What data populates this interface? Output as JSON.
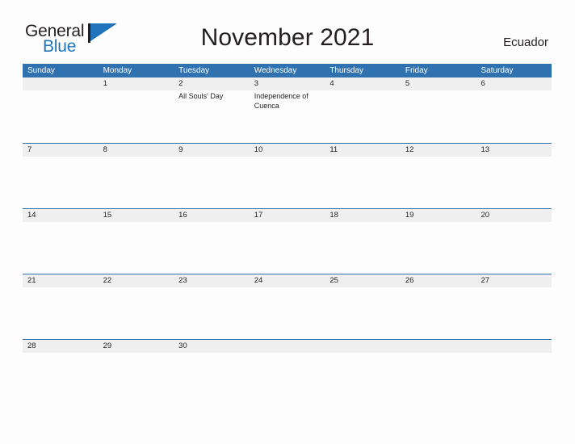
{
  "brand": {
    "name_part1": "General",
    "name_part2": "Blue",
    "flag_icon": "pennant-flag-icon",
    "accent_color": "#1f74bb"
  },
  "header": {
    "title": "November 2021",
    "country": "Ecuador"
  },
  "calendar": {
    "header_bg_color": "#3072b0",
    "band_bg_color": "#efefef",
    "day_names": [
      "Sunday",
      "Monday",
      "Tuesday",
      "Wednesday",
      "Thursday",
      "Friday",
      "Saturday"
    ],
    "weeks": [
      [
        {
          "day": "",
          "event": ""
        },
        {
          "day": "1",
          "event": ""
        },
        {
          "day": "2",
          "event": "All Souls' Day"
        },
        {
          "day": "3",
          "event": "Independence of Cuenca"
        },
        {
          "day": "4",
          "event": ""
        },
        {
          "day": "5",
          "event": ""
        },
        {
          "day": "6",
          "event": ""
        }
      ],
      [
        {
          "day": "7",
          "event": ""
        },
        {
          "day": "8",
          "event": ""
        },
        {
          "day": "9",
          "event": ""
        },
        {
          "day": "10",
          "event": ""
        },
        {
          "day": "11",
          "event": ""
        },
        {
          "day": "12",
          "event": ""
        },
        {
          "day": "13",
          "event": ""
        }
      ],
      [
        {
          "day": "14",
          "event": ""
        },
        {
          "day": "15",
          "event": ""
        },
        {
          "day": "16",
          "event": ""
        },
        {
          "day": "17",
          "event": ""
        },
        {
          "day": "18",
          "event": ""
        },
        {
          "day": "19",
          "event": ""
        },
        {
          "day": "20",
          "event": ""
        }
      ],
      [
        {
          "day": "21",
          "event": ""
        },
        {
          "day": "22",
          "event": ""
        },
        {
          "day": "23",
          "event": ""
        },
        {
          "day": "24",
          "event": ""
        },
        {
          "day": "25",
          "event": ""
        },
        {
          "day": "26",
          "event": ""
        },
        {
          "day": "27",
          "event": ""
        }
      ],
      [
        {
          "day": "28",
          "event": ""
        },
        {
          "day": "29",
          "event": ""
        },
        {
          "day": "30",
          "event": ""
        },
        {
          "day": "",
          "event": ""
        },
        {
          "day": "",
          "event": ""
        },
        {
          "day": "",
          "event": ""
        },
        {
          "day": "",
          "event": ""
        }
      ]
    ]
  }
}
